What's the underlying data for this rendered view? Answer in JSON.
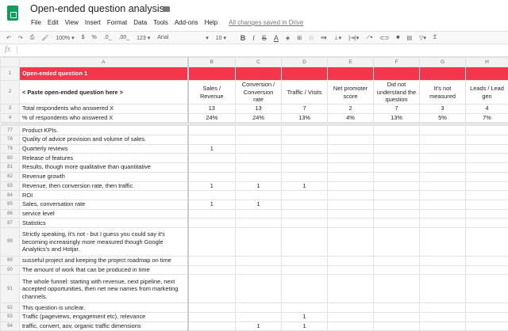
{
  "app": {
    "title": "Open-ended question analysis",
    "save_status": "All changes saved in Drive",
    "menu": [
      "File",
      "Edit",
      "View",
      "Insert",
      "Format",
      "Data",
      "Tools",
      "Add-ons",
      "Help"
    ],
    "brand_color": "#0f9d58"
  },
  "toolbar": {
    "zoom": "100%",
    "currency": "$",
    "percent": "%",
    "dec_less": ".0_",
    "dec_more": ".00_",
    "format": "123 ▾",
    "font": "Arial",
    "font_size": "10"
  },
  "formula_bar": {
    "label": "fx",
    "value": ""
  },
  "sheet": {
    "header_color": "#f4364c",
    "columns": [
      "A",
      "B",
      "C",
      "D",
      "E",
      "F",
      "G",
      "H"
    ],
    "row1": {
      "num": "1",
      "label": "Open-ended question 1"
    },
    "row2": {
      "num": "2",
      "label": "< Paste open-ended question here >",
      "categories": [
        "Sales / Revenue",
        "Conversion / Conversion rate",
        "Traffic / Visits",
        "Net promoter score",
        "Did not understand the question",
        "It's not measured",
        "Leads / Lead gen"
      ]
    },
    "row3": {
      "num": "3",
      "label": "Total respondents who answered X",
      "values": [
        "13",
        "13",
        "7",
        "2",
        "7",
        "3",
        "4"
      ]
    },
    "row4": {
      "num": "4",
      "label": "% of respondents who answered X",
      "values": [
        "24%",
        "24%",
        "13%",
        "4%",
        "13%",
        "5%",
        "7%"
      ]
    },
    "rows": [
      {
        "num": "77",
        "text": "Product KPIs.",
        "values": [
          "",
          "",
          "",
          "",
          "",
          "",
          ""
        ]
      },
      {
        "num": "78",
        "text": "Quality of advice provision and volume of sales.",
        "values": [
          "",
          "",
          "",
          "",
          "",
          "",
          ""
        ]
      },
      {
        "num": "79",
        "text": "Quarterly reviews",
        "values": [
          "1",
          "",
          "",
          "",
          "",
          "",
          ""
        ]
      },
      {
        "num": "80",
        "text": "Release of features",
        "values": [
          "",
          "",
          "",
          "",
          "",
          "",
          ""
        ]
      },
      {
        "num": "81",
        "text": "Results, though more qualitative than quantitative",
        "values": [
          "",
          "",
          "",
          "",
          "",
          "",
          ""
        ]
      },
      {
        "num": "82",
        "text": "Revenue growth",
        "values": [
          "",
          "",
          "",
          "",
          "",
          "",
          ""
        ]
      },
      {
        "num": "83",
        "text": "Revenue, then conversion rate, then traffic.",
        "values": [
          "1",
          "1",
          "1",
          "",
          "",
          "",
          ""
        ]
      },
      {
        "num": "84",
        "text": "ROI",
        "values": [
          "",
          "",
          "",
          "",
          "",
          "",
          ""
        ]
      },
      {
        "num": "85",
        "text": "Sales,  conversation rate",
        "values": [
          "1",
          "1",
          "",
          "",
          "",
          "",
          ""
        ]
      },
      {
        "num": "86",
        "text": "service level",
        "values": [
          "",
          "",
          "",
          "",
          "",
          "",
          ""
        ]
      },
      {
        "num": "87",
        "text": "Statistics",
        "values": [
          "",
          "",
          "",
          "",
          "",
          "",
          ""
        ]
      },
      {
        "num": "88",
        "text": "Strictly speaking, it's not - but I guess you could say it's becoming increasingly more measured though Google Analytics's and Hotjar.",
        "values": [
          "",
          "",
          "",
          "",
          "",
          "",
          ""
        ],
        "wrap": true
      },
      {
        "num": "89",
        "text": "susseful project and keeping the project roadmap on time",
        "values": [
          "",
          "",
          "",
          "",
          "",
          "",
          ""
        ]
      },
      {
        "num": "90",
        "text": "The amount of work that can be produced in time",
        "values": [
          "",
          "",
          "",
          "",
          "",
          "",
          ""
        ]
      },
      {
        "num": "91",
        "text": "The whole funnel: starting with revenue, next pipeline, next accepted opportunities, then net new names from marketing channels.",
        "values": [
          "",
          "",
          "",
          "",
          "",
          "",
          ""
        ],
        "wrap": true
      },
      {
        "num": "92",
        "text": "This question is unclear.",
        "values": [
          "",
          "",
          "",
          "",
          "",
          "",
          ""
        ]
      },
      {
        "num": "93",
        "text": "Traffic (pageviews, engagement etc), relevance",
        "values": [
          "",
          "",
          "1",
          "",
          "",
          "",
          ""
        ]
      },
      {
        "num": "94",
        "text": "traffic, convert, aov, organic traffic dimensions",
        "values": [
          "",
          "1",
          "1",
          "",
          "",
          "",
          ""
        ]
      }
    ]
  }
}
